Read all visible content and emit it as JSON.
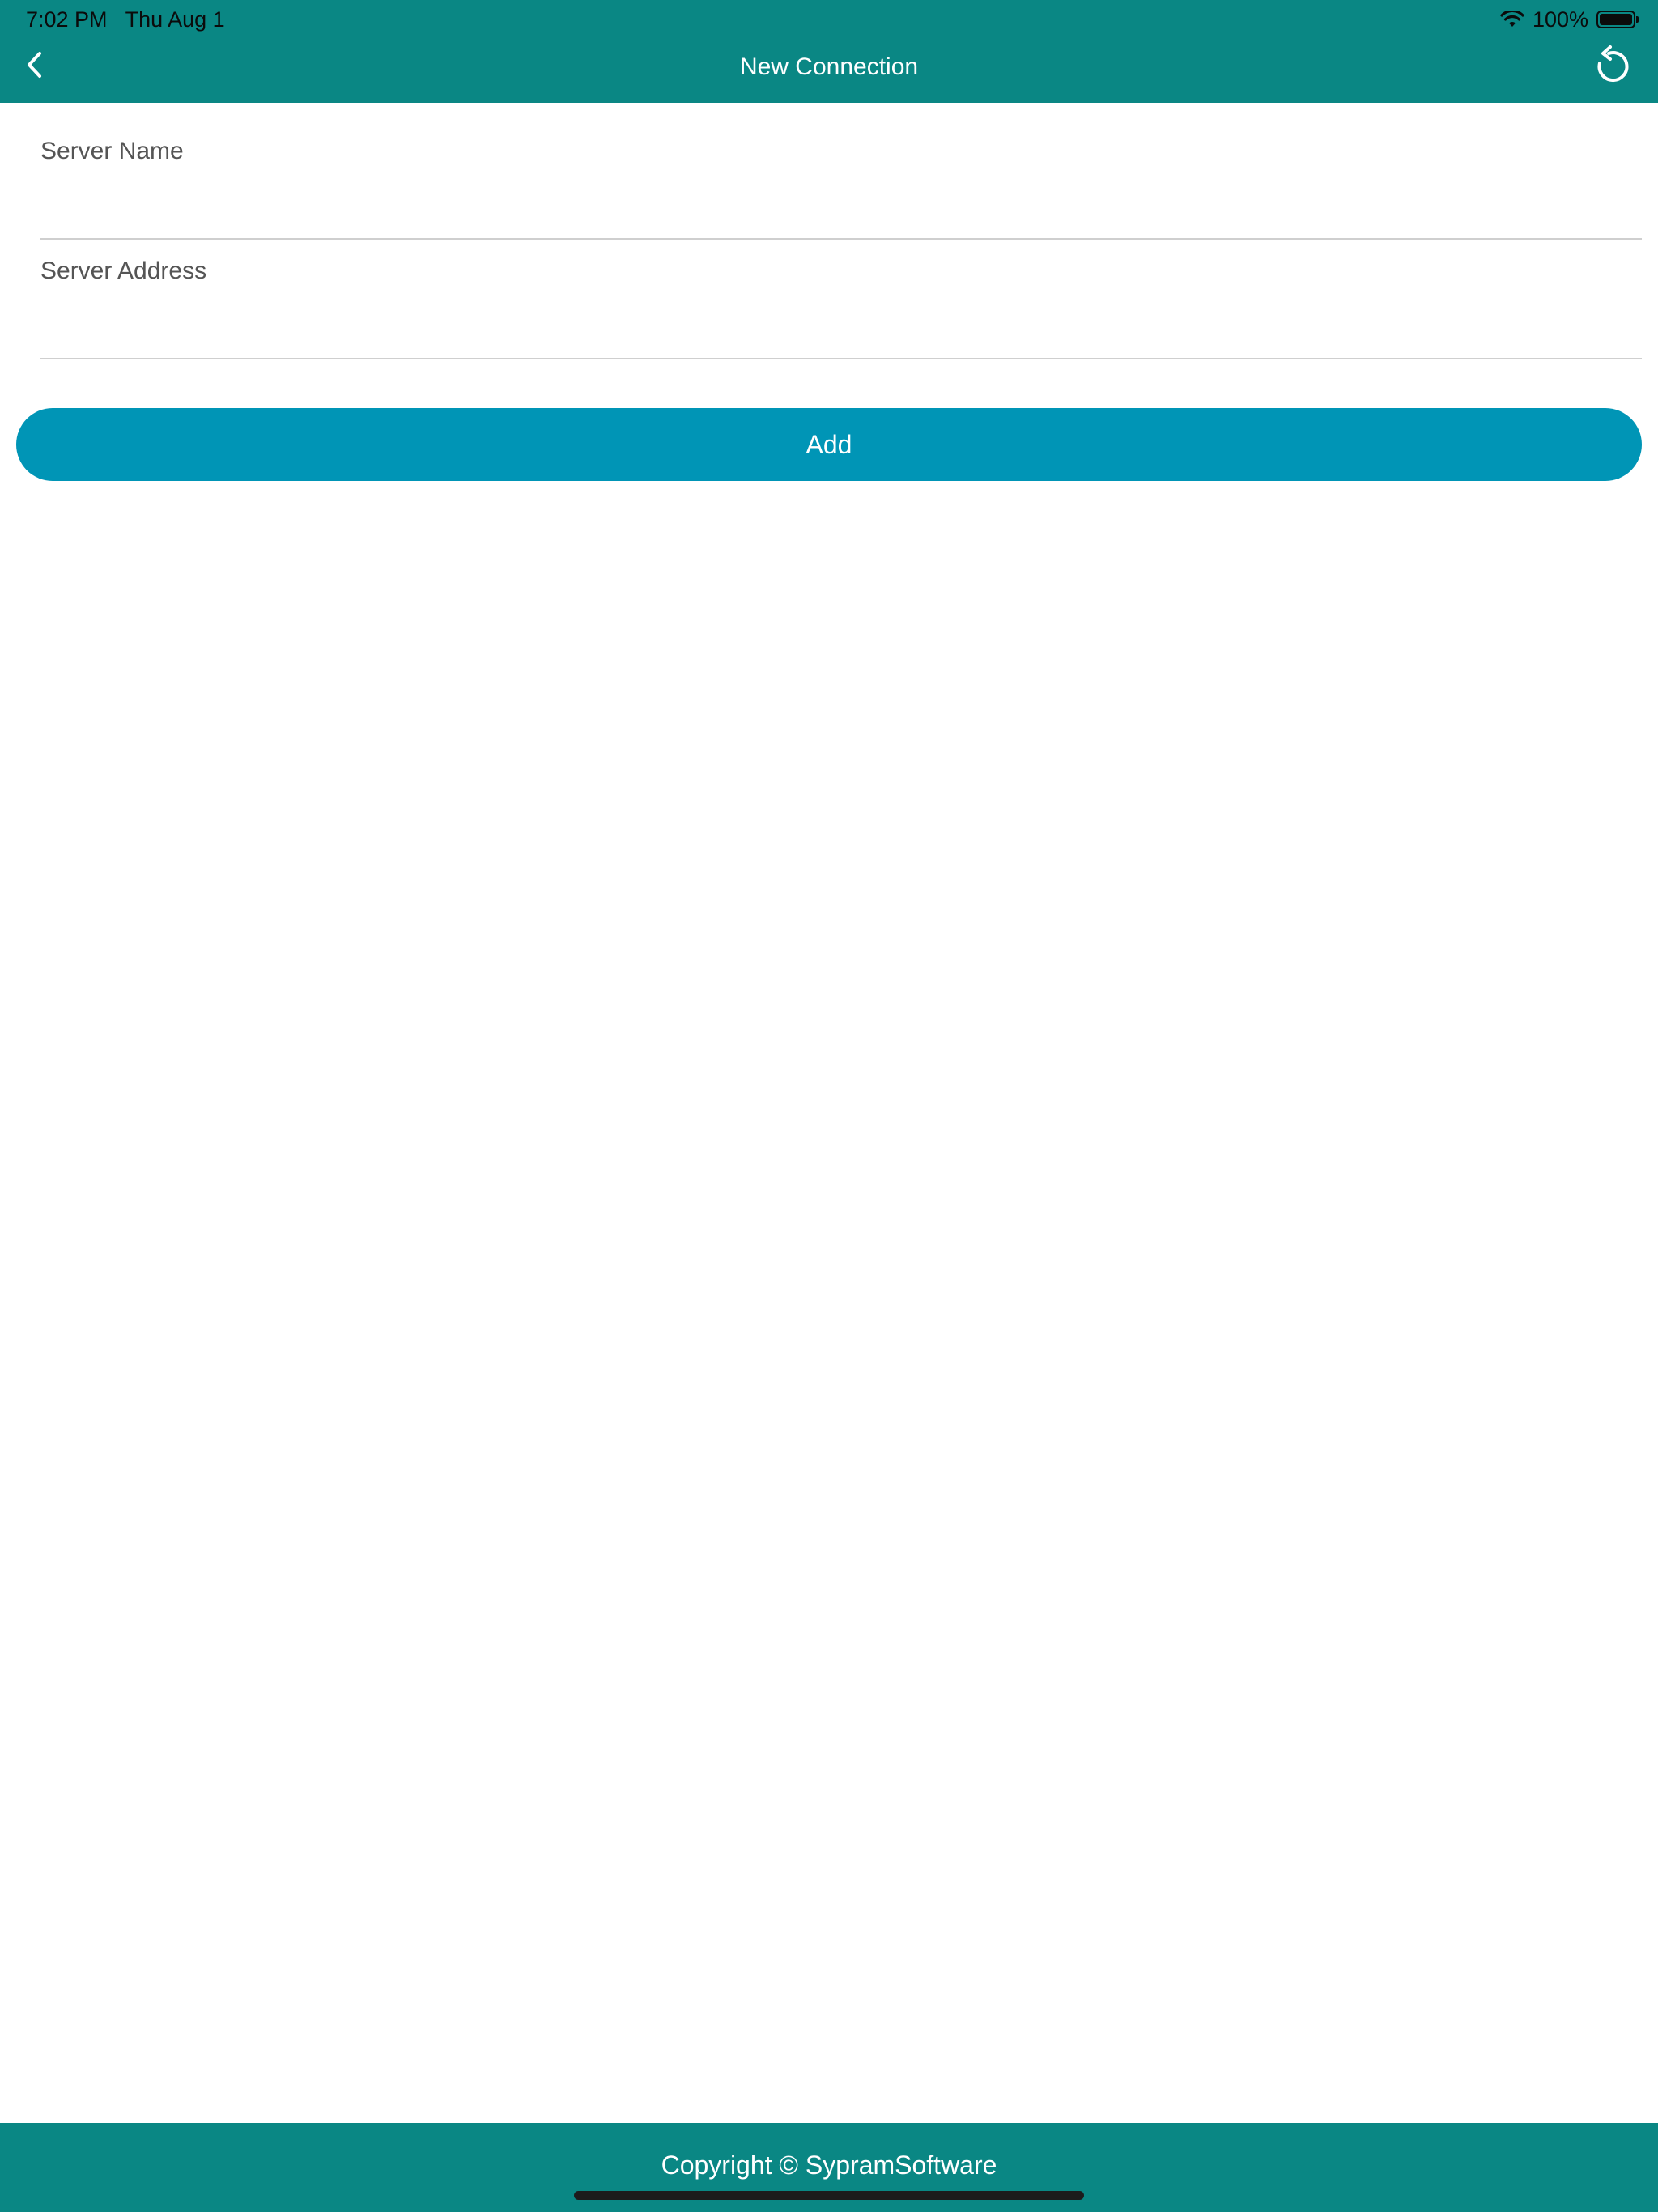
{
  "status_bar": {
    "time": "7:02 PM",
    "date": "Thu Aug 1",
    "battery_percent": "100%",
    "battery_level": 1.0
  },
  "nav": {
    "title": "New Connection",
    "back_icon": "chevron-left-icon",
    "refresh_icon": "refresh-icon"
  },
  "form": {
    "server_name": {
      "label": "Server Name",
      "value": "",
      "placeholder": ""
    },
    "server_address": {
      "label": "Server Address",
      "value": "",
      "placeholder": ""
    },
    "add_label": "Add"
  },
  "footer": {
    "copyright": "Copyright © SypramSoftware"
  },
  "colors": {
    "header": "#0a8784",
    "button": "#0095b6",
    "footer": "#0a8784"
  }
}
